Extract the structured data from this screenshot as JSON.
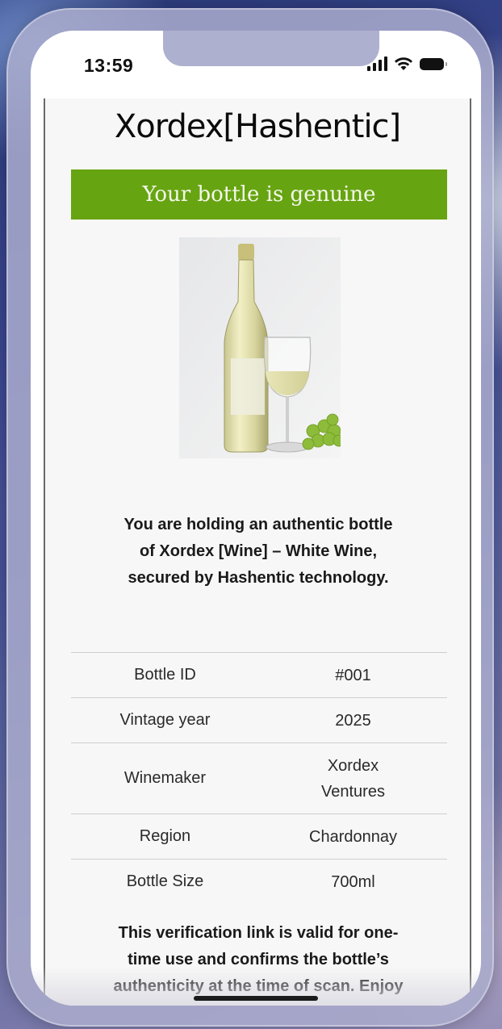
{
  "status_bar": {
    "time": "13:59",
    "icons": [
      "cellular-signal-icon",
      "wifi-icon",
      "battery-icon"
    ]
  },
  "brand": {
    "name": "Xordex[Hashentic]"
  },
  "banner": {
    "text": "Your bottle is genuine",
    "color": "#67a412"
  },
  "image": {
    "subject": "white wine bottle and glass with grapes"
  },
  "intro": {
    "text": "You are holding an authentic bottle of Xordex [Wine] – White Wine, secured by Hashentic technology."
  },
  "details": {
    "rows": [
      {
        "label": "Bottle ID",
        "value": "#001"
      },
      {
        "label": "Vintage year",
        "value": "2025"
      },
      {
        "label": "Winemaker",
        "value": "Xordex Ventures"
      },
      {
        "label": "Region",
        "value": "Chardonnay"
      },
      {
        "label": "Bottle Size",
        "value": "700ml"
      }
    ]
  },
  "footer": {
    "text": "This verification link is valid for one-time use and confirms the bottle’s authenticity at the time of scan. Enjoy responsibly."
  }
}
